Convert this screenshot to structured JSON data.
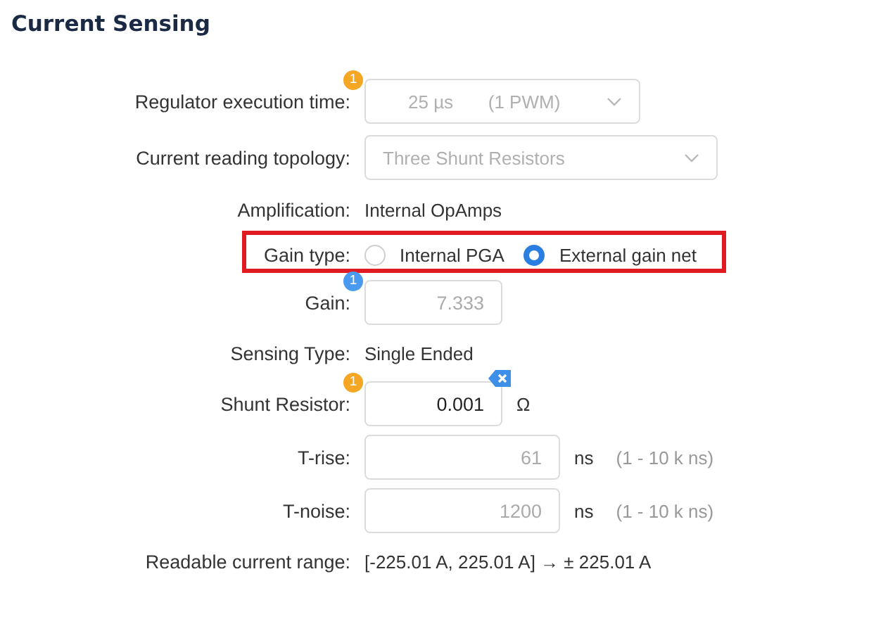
{
  "title": "Current Sensing",
  "fields": [
    {
      "label": "Regulator execution time:",
      "kind": "select",
      "badge": {
        "text": "1",
        "color": "#f5a623"
      },
      "value_parts": [
        "25 µs",
        "(1 PWM)"
      ],
      "disabled": true
    },
    {
      "label": "Current reading topology:",
      "kind": "select",
      "value_parts": [
        "Three Shunt Resistors"
      ],
      "disabled": true
    },
    {
      "label": "Amplification:",
      "kind": "text",
      "value": "Internal OpAmps"
    },
    {
      "label": "Gain type:",
      "kind": "radio",
      "highlighted": true,
      "options": [
        {
          "label": "Internal PGA",
          "selected": false
        },
        {
          "label": "External gain net",
          "selected": true
        }
      ]
    },
    {
      "label": "Gain:",
      "kind": "number",
      "badge": {
        "text": "1",
        "color": "#4a9bf0"
      },
      "value": "7.333",
      "disabled": true
    },
    {
      "label": "Sensing Type:",
      "kind": "text",
      "value": "Single Ended"
    },
    {
      "label": "Shunt Resistor:",
      "kind": "number",
      "badge": {
        "text": "1",
        "color": "#f5a623"
      },
      "value": "0.001",
      "disabled": false,
      "clearable": true,
      "unit": "Ω"
    },
    {
      "label": "T-rise:",
      "kind": "number",
      "value": "61",
      "disabled": true,
      "unit": "ns",
      "hint": "(1 - 10 k ns)"
    },
    {
      "label": "T-noise:",
      "kind": "number",
      "value": "1200",
      "disabled": true,
      "unit": "ns",
      "hint": "(1 - 10 k ns)"
    },
    {
      "label": "Readable current range:",
      "kind": "text",
      "value": "[-225.01 A, 225.01 A] → ± 225.01 A"
    }
  ]
}
